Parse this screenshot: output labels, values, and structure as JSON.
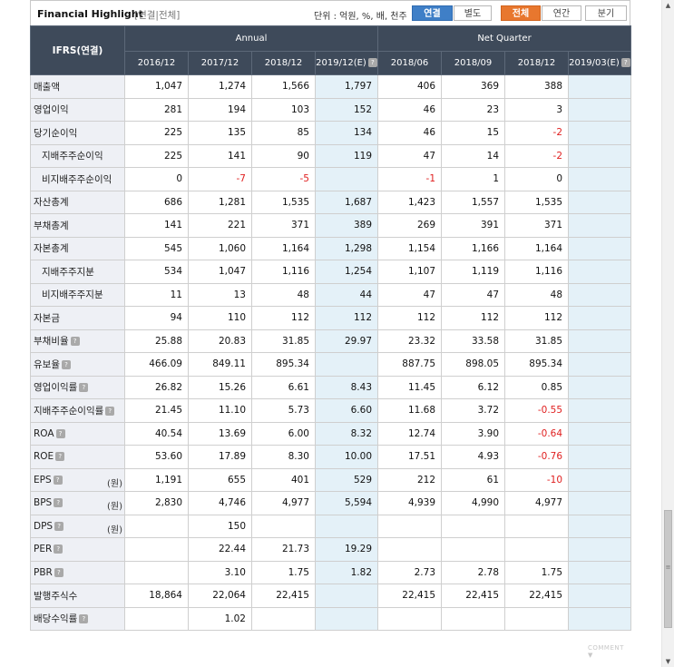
{
  "header": {
    "title": "Financial Highlight",
    "subtitle": "[연결|전체]",
    "unit": "단위 : 억원, %, 배, 천주",
    "buttons": [
      "연결",
      "별도",
      "전체",
      "연간",
      "분기"
    ]
  },
  "table": {
    "ifrs_label": "IFRS(연결)",
    "group_annual": "Annual",
    "group_quarter": "Net Quarter",
    "periods": [
      "2016/12",
      "2017/12",
      "2018/12",
      "2019/12(E)",
      "2018/06",
      "2018/09",
      "2018/12",
      "2019/03(E)"
    ],
    "rows": [
      {
        "label": "매출액",
        "values": [
          "1,047",
          "1,274",
          "1,566",
          "1,797",
          "406",
          "369",
          "388",
          ""
        ]
      },
      {
        "label": "영업이익",
        "values": [
          "281",
          "194",
          "103",
          "152",
          "46",
          "23",
          "3",
          ""
        ]
      },
      {
        "label": "당기순이익",
        "values": [
          "225",
          "135",
          "85",
          "134",
          "46",
          "15",
          "-2",
          ""
        ]
      },
      {
        "label": "지배주주순이익",
        "values": [
          "225",
          "141",
          "90",
          "119",
          "47",
          "14",
          "-2",
          ""
        ]
      },
      {
        "label": "비지배주주순이익",
        "values": [
          "0",
          "-7",
          "-5",
          "",
          "-1",
          "1",
          "0",
          ""
        ]
      },
      {
        "label": "자산총계",
        "values": [
          "686",
          "1,281",
          "1,535",
          "1,687",
          "1,423",
          "1,557",
          "1,535",
          ""
        ]
      },
      {
        "label": "부채총계",
        "values": [
          "141",
          "221",
          "371",
          "389",
          "269",
          "391",
          "371",
          ""
        ]
      },
      {
        "label": "자본총계",
        "values": [
          "545",
          "1,060",
          "1,164",
          "1,298",
          "1,154",
          "1,166",
          "1,164",
          ""
        ]
      },
      {
        "label": "지배주주지분",
        "values": [
          "534",
          "1,047",
          "1,116",
          "1,254",
          "1,107",
          "1,119",
          "1,116",
          ""
        ]
      },
      {
        "label": "비지배주주지분",
        "values": [
          "11",
          "13",
          "48",
          "44",
          "47",
          "47",
          "48",
          ""
        ]
      },
      {
        "label": "자본금",
        "values": [
          "94",
          "110",
          "112",
          "112",
          "112",
          "112",
          "112",
          ""
        ]
      },
      {
        "label": "부채비율",
        "values": [
          "25.88",
          "20.83",
          "31.85",
          "29.97",
          "23.32",
          "33.58",
          "31.85",
          ""
        ]
      },
      {
        "label": "유보율",
        "values": [
          "466.09",
          "849.11",
          "895.34",
          "",
          "887.75",
          "898.05",
          "895.34",
          ""
        ]
      },
      {
        "label": "영업이익률",
        "values": [
          "26.82",
          "15.26",
          "6.61",
          "8.43",
          "11.45",
          "6.12",
          "0.85",
          ""
        ]
      },
      {
        "label": "지배주주순이익률",
        "values": [
          "21.45",
          "11.10",
          "5.73",
          "6.60",
          "11.68",
          "3.72",
          "-0.55",
          ""
        ]
      },
      {
        "label": "ROA",
        "values": [
          "40.54",
          "13.69",
          "6.00",
          "8.32",
          "12.74",
          "3.90",
          "-0.64",
          ""
        ]
      },
      {
        "label": "ROE",
        "values": [
          "53.60",
          "17.89",
          "8.30",
          "10.00",
          "17.51",
          "4.93",
          "-0.76",
          ""
        ]
      },
      {
        "label": "EPS",
        "unit": "(원)",
        "values": [
          "1,191",
          "655",
          "401",
          "529",
          "212",
          "61",
          "-10",
          ""
        ]
      },
      {
        "label": "BPS",
        "unit": "(원)",
        "values": [
          "2,830",
          "4,746",
          "4,977",
          "5,594",
          "4,939",
          "4,990",
          "4,977",
          ""
        ]
      },
      {
        "label": "DPS",
        "unit": "(원)",
        "values": [
          "",
          "150",
          "",
          "",
          "",
          "",
          "",
          ""
        ]
      },
      {
        "label": "PER",
        "values": [
          "",
          "22.44",
          "21.73",
          "19.29",
          "",
          "",
          "",
          ""
        ]
      },
      {
        "label": "PBR",
        "values": [
          "",
          "3.10",
          "1.75",
          "1.82",
          "2.73",
          "2.78",
          "1.75",
          ""
        ]
      },
      {
        "label": "발행주식수",
        "values": [
          "18,864",
          "22,064",
          "22,415",
          "",
          "22,415",
          "22,415",
          "22,415",
          ""
        ]
      },
      {
        "label": "배당수익률",
        "values": [
          "",
          "1.02",
          "",
          "",
          "",
          "",
          "",
          ""
        ]
      }
    ]
  },
  "footer": {
    "comment": "COMMENT ▼"
  }
}
